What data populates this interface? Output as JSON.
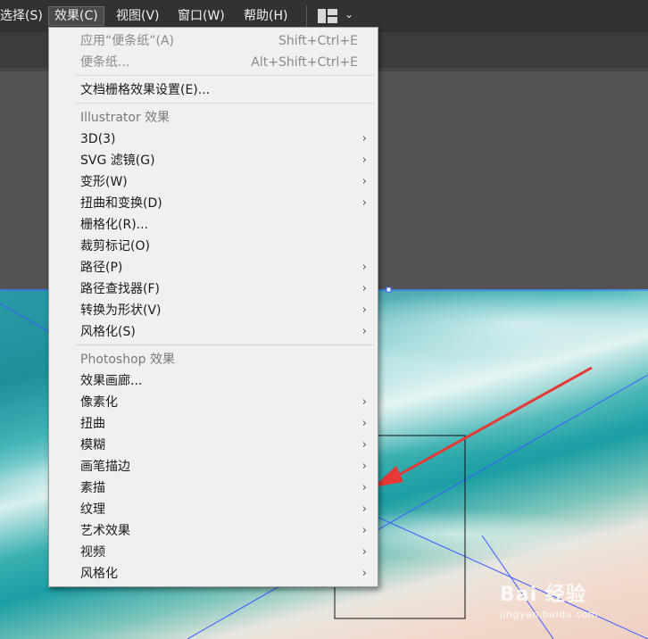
{
  "menubar": {
    "items": [
      "选择(S)",
      "效果(C)",
      "视图(V)",
      "窗口(W)",
      "帮助(H)"
    ],
    "chevron": "⌄",
    "icons": {
      "workspace": "workspace-layout-icon"
    }
  },
  "dropdown": {
    "apply_last": {
      "label": "应用“便条纸”(A)",
      "shortcut": "Shift+Ctrl+E"
    },
    "last_effect": {
      "label": "便条纸...",
      "shortcut": "Alt+Shift+Ctrl+E"
    },
    "doc_raster": "文档栅格效果设置(E)...",
    "illustrator_header": "Illustrator 效果",
    "illustrator_items": [
      "3D(3)",
      "SVG 滤镜(G)",
      "变形(W)",
      "扭曲和变换(D)",
      "栅格化(R)...",
      "裁剪标记(O)",
      "路径(P)",
      "路径查找器(F)",
      "转换为形状(V)",
      "风格化(S)"
    ],
    "photoshop_header": "Photoshop 效果",
    "photoshop_items": [
      "效果画廊...",
      "像素化",
      "扭曲",
      "模糊",
      "画笔描边",
      "素描",
      "纹理",
      "艺术效果",
      "视频",
      "风格化"
    ],
    "submenu_arrow": "›"
  },
  "watermark": {
    "main": "Bai  经验",
    "sub": "jingyan.baidu.com"
  },
  "colors": {
    "annotation_arrow": "#e53935",
    "guide_line": "#3a5bff",
    "menu_bg": "#f0f0f0"
  }
}
